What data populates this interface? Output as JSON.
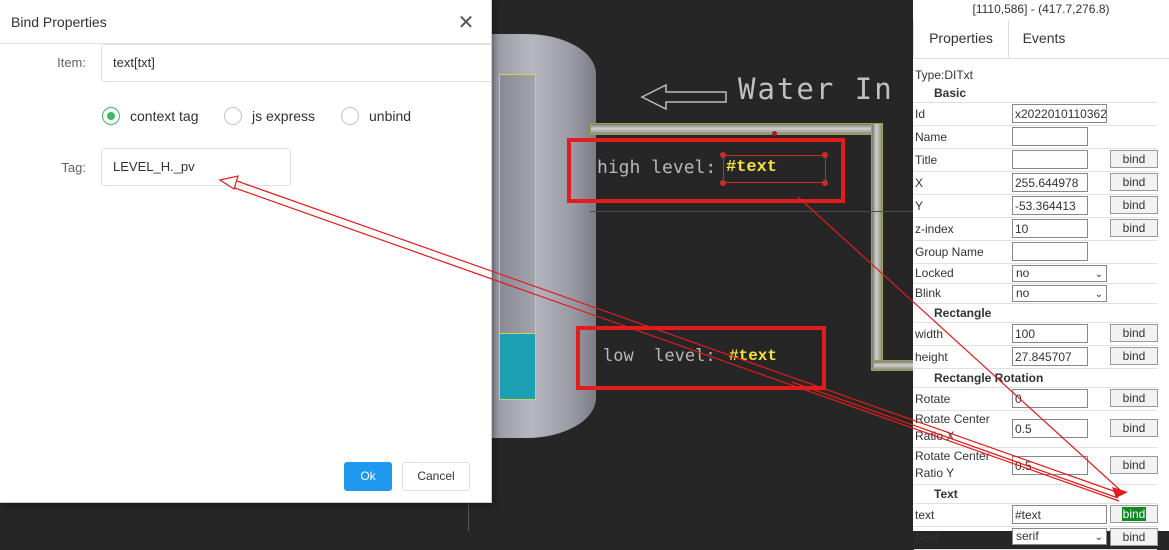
{
  "dialog": {
    "title": "Bind Properties",
    "item_label": "Item:",
    "item_value": "text[txt]",
    "radio_options": [
      "context tag",
      "js express",
      "unbind"
    ],
    "radio_selected": "context tag",
    "tag_label": "Tag:",
    "tag_value": "LEVEL_H._pv",
    "ok_label": "Ok",
    "cancel_label": "Cancel"
  },
  "canvas": {
    "water_in": "Water In",
    "high_label": "high level:",
    "high_value": "#text",
    "low_label": "low  level:",
    "low_value": "#text",
    "tank_level_fraction": 0.2
  },
  "panel": {
    "coords": "[1110,586] - (417.7,276.8)",
    "tabs": [
      "Properties",
      "Events"
    ],
    "active_tab": "Properties",
    "type": "Type:DITxt",
    "sections": {
      "basic": "Basic",
      "rectangle": "Rectangle",
      "rotation": "Rectangle Rotation",
      "text": "Text"
    },
    "rows": {
      "id": {
        "label": "Id",
        "value": "x2022010110362"
      },
      "name": {
        "label": "Name",
        "value": ""
      },
      "title": {
        "label": "Title",
        "value": ""
      },
      "x": {
        "label": "X",
        "value": "255.644978"
      },
      "y": {
        "label": "Y",
        "value": "-53.364413"
      },
      "zindex": {
        "label": "z-index",
        "value": "10"
      },
      "group": {
        "label": "Group Name",
        "value": ""
      },
      "locked": {
        "label": "Locked",
        "value": "no"
      },
      "blink": {
        "label": "Blink",
        "value": "no"
      },
      "width": {
        "label": "width",
        "value": "100"
      },
      "height": {
        "label": "height",
        "value": "27.845707"
      },
      "rotate": {
        "label": "Rotate",
        "value": "0"
      },
      "rcx": {
        "label": "Rotate Center Ratio X",
        "value": "0.5"
      },
      "rcy": {
        "label": "Rotate Center Ratio Y",
        "value": "0.5"
      },
      "text": {
        "label": "text",
        "value": "#text"
      },
      "font": {
        "label": "Font",
        "value": "serif"
      }
    },
    "bind_label": "bind"
  }
}
